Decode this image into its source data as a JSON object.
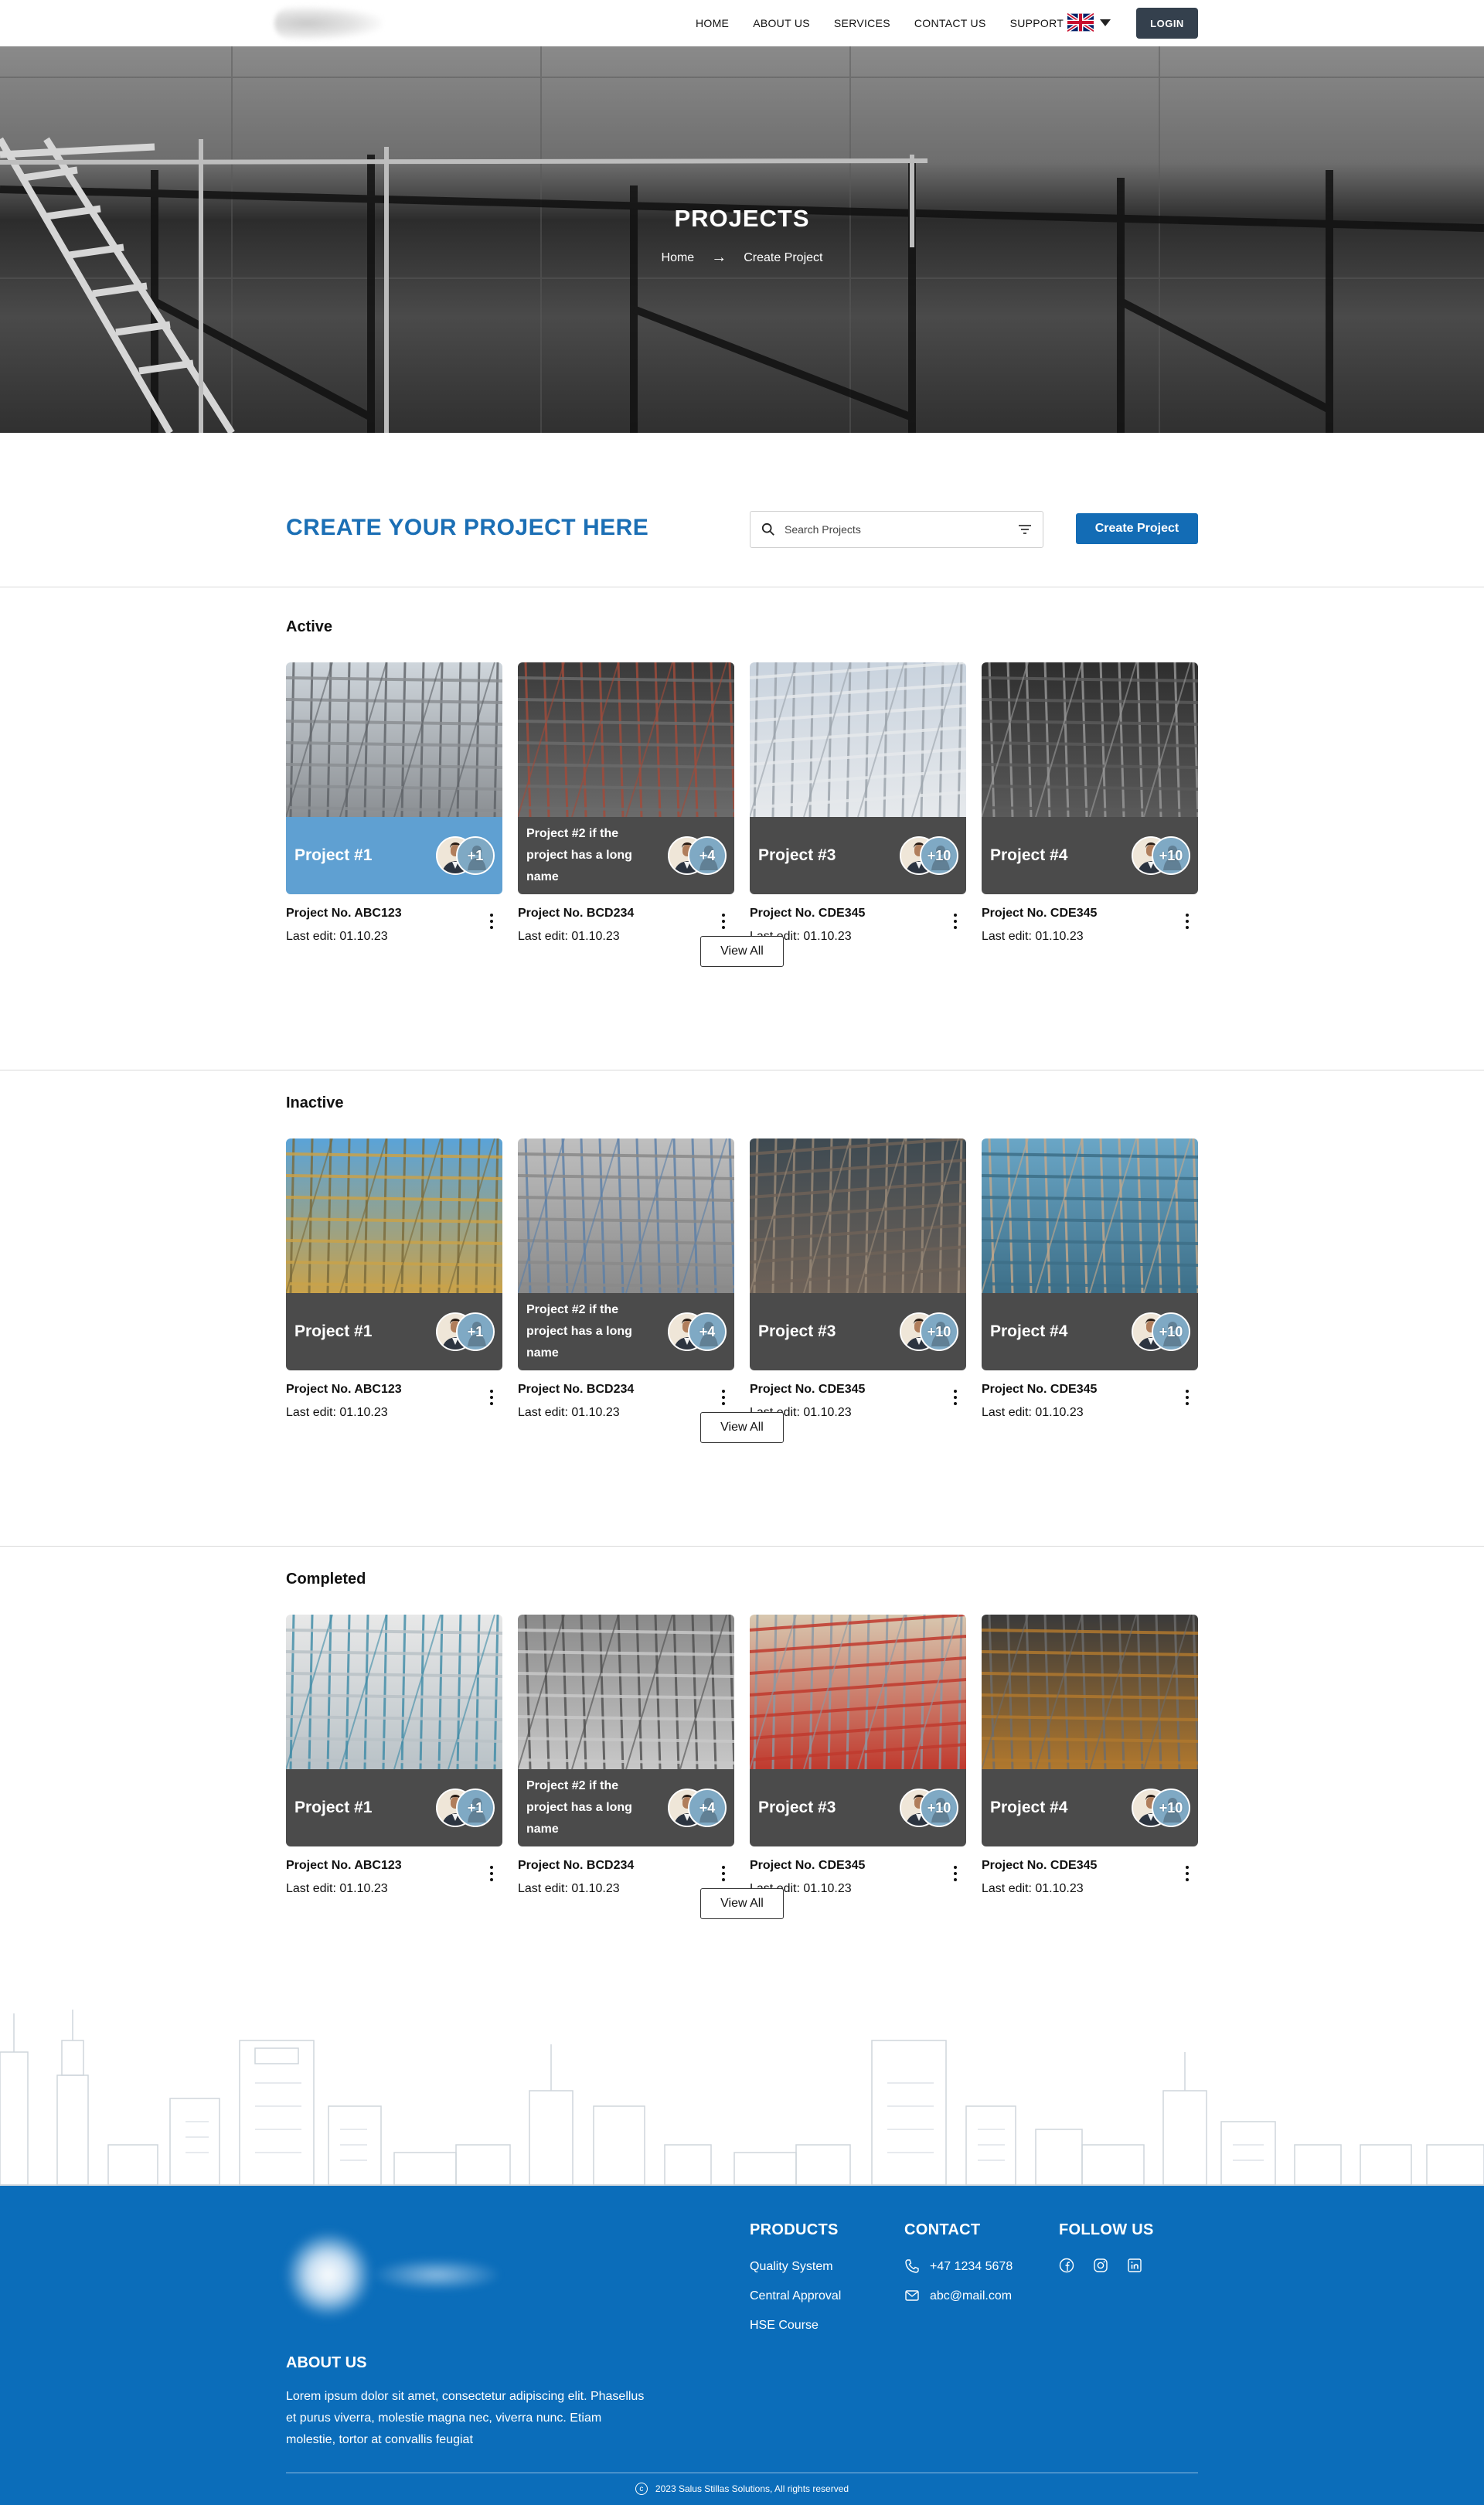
{
  "nav": {
    "links": [
      "HOME",
      "ABOUT US",
      "SERVICES",
      "CONTACT US",
      "SUPPORT"
    ],
    "login_label": "LOGIN"
  },
  "hero": {
    "title": "PROJECTS",
    "breadcrumb": {
      "home": "Home",
      "current": "Create Project"
    }
  },
  "create": {
    "heading": "CREATE YOUR PROJECT HERE",
    "search_placeholder": "Search Projects",
    "button_label": "Create Project"
  },
  "sections": [
    {
      "title": "Active",
      "view_all": "View All",
      "cards": [
        {
          "name": "Project #1",
          "extra": "+1",
          "number": "Project No. ABC123",
          "last_edit": "Last edit: 01.10.23",
          "highlight": true
        },
        {
          "name": "Project #2 if the project has a long name",
          "extra": "+4",
          "number": "Project No. BCD234",
          "last_edit": "Last edit: 01.10.23"
        },
        {
          "name": "Project #3",
          "extra": "+10",
          "number": "Project No. CDE345",
          "last_edit": "Last edit: 01.10.23"
        },
        {
          "name": "Project #4",
          "extra": "+10",
          "number": "Project No. CDE345",
          "last_edit": "Last edit: 01.10.23"
        }
      ]
    },
    {
      "title": "Inactive",
      "view_all": "View All",
      "cards": [
        {
          "name": "Project #1",
          "extra": "+1",
          "number": "Project No. ABC123",
          "last_edit": "Last edit: 01.10.23"
        },
        {
          "name": "Project #2 if the project has a long name",
          "extra": "+4",
          "number": "Project No. BCD234",
          "last_edit": "Last edit: 01.10.23"
        },
        {
          "name": "Project #3",
          "extra": "+10",
          "number": "Project No. CDE345",
          "last_edit": "Last edit: 01.10.23"
        },
        {
          "name": "Project #4",
          "extra": "+10",
          "number": "Project No. CDE345",
          "last_edit": "Last edit: 01.10.23"
        }
      ]
    },
    {
      "title": "Completed",
      "view_all": "View All",
      "cards": [
        {
          "name": "Project #1",
          "extra": "+1",
          "number": "Project No. ABC123",
          "last_edit": "Last edit: 01.10.23"
        },
        {
          "name": "Project #2 if the project has a long name",
          "extra": "+4",
          "number": "Project No. BCD234",
          "last_edit": "Last edit: 01.10.23"
        },
        {
          "name": "Project #3",
          "extra": "+10",
          "number": "Project No. CDE345",
          "last_edit": "Last edit: 01.10.23"
        },
        {
          "name": "Project #4",
          "extra": "+10",
          "number": "Project No. CDE345",
          "last_edit": "Last edit: 01.10.23"
        }
      ]
    }
  ],
  "footer": {
    "products_title": "PRODUCTS",
    "products": [
      "Quality System",
      "Central Approval",
      "HSE Course"
    ],
    "contact_title": "CONTACT",
    "phone": "+47 1234 5678",
    "email": "abc@mail.com",
    "follow_title": "FOLLOW US",
    "about_title": "ABOUT US",
    "about_text": "Lorem ipsum dolor sit amet, consectetur adipiscing elit. Phasellus et purus viverra, molestie magna nec, viverra nunc. Etiam molestie, tortor at convallis feugiat",
    "copyright": "2023 Salus Stillas Solutions, All rights reserved"
  },
  "colors": {
    "brand_blue": "#0b6dba",
    "heading_blue": "#1b6fb5",
    "card_band": "#4b4b4b",
    "card_band_active": "#5fa0d2",
    "login_bg": "#34404d"
  },
  "icons": [
    "search-icon",
    "filter-icon",
    "uk-flag-icon",
    "chevron-down-icon",
    "arrow-right-icon",
    "kebab-menu-icon",
    "phone-icon",
    "mail-icon",
    "facebook-icon",
    "instagram-icon",
    "linkedin-icon",
    "copyright-icon"
  ]
}
